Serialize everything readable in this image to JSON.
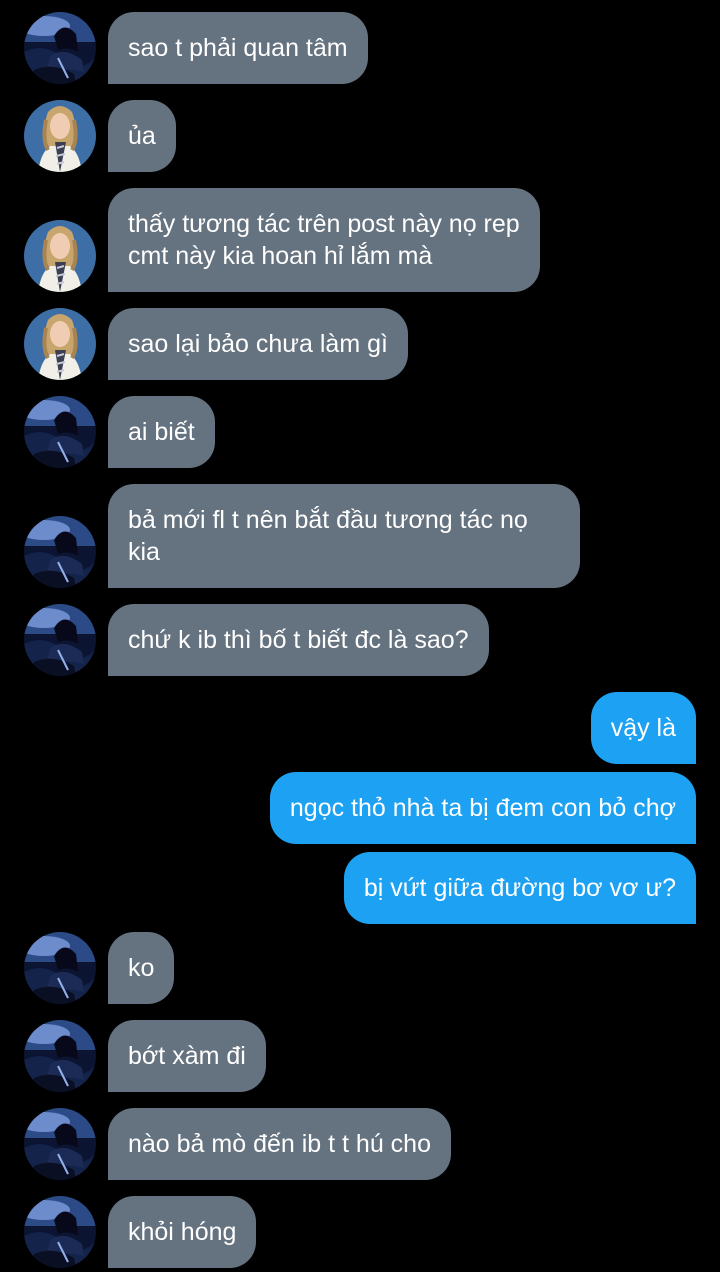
{
  "avatars": {
    "a": "avatar-dark-blue-portrait",
    "b": "avatar-blonde-woman-tie"
  },
  "colors": {
    "background": "#000000",
    "incoming": "#65727f",
    "outgoing": "#1da1f2",
    "text": "#ffffff"
  },
  "messages": [
    {
      "text": "sao t phải quan tâm"
    },
    {
      "text": "ủa"
    },
    {
      "text": "thấy tương tác trên post này nọ rep\ncmt này kia hoan hỉ lắm mà"
    },
    {
      "text": "sao lại bảo chưa làm gì"
    },
    {
      "text": "ai biết"
    },
    {
      "text": "bả mới fl t nên bắt đầu tương tác nọ\nkia"
    },
    {
      "text": "chứ k ib thì bố t biết đc là sao?"
    },
    {
      "text": "vậy là"
    },
    {
      "text": "ngọc thỏ nhà ta bị đem con bỏ chợ"
    },
    {
      "text": "bị vứt giữa đường bơ vơ ư?"
    },
    {
      "text": "ko"
    },
    {
      "text": "bớt xàm đi"
    },
    {
      "text": "nào bả mò đến ib t t hú cho"
    },
    {
      "text": "khỏi hóng"
    }
  ]
}
